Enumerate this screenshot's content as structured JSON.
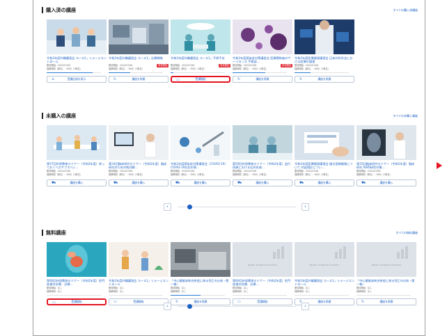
{
  "purchased": {
    "title": "購入済の講座",
    "link": "すべての購入済講座",
    "cards": [
      {
        "title": "令和2年度外職講習会 コース1」リメージコントロール",
        "tag": "",
        "meta1": "配信開始：2022/07/05",
        "meta2": "講師時間（単位）：60分（1単位）",
        "badge": "",
        "progress": 0.85,
        "button": "受講記録を表示",
        "icon": "user-icon",
        "scene": "team"
      },
      {
        "title": "令和2年度外職講習会 コース1」治療戦略",
        "tag": "",
        "meta1": "配信開始：2022/07/06",
        "meta2": "講師時間（単位）：60分（1単位）",
        "badge": "本日配信",
        "progress": 0.4,
        "button": "講座を再開",
        "icon": "refresh-icon",
        "scene": "lab"
      },
      {
        "title": "令和2年度外職講習会 コース1」手術手技",
        "tag": "",
        "meta1": "配信開始：2022/07/06",
        "meta2": "講師時間（単位）：60分（1単位）",
        "badge": "本日配信",
        "progress": 0.05,
        "button": "受講開始",
        "icon": "book-icon",
        "scene": "surgery"
      },
      {
        "title": "令和2年度感染症対策講習会 医療関係者のサーベランス 手術部…",
        "tag": "",
        "meta1": "配信開始：2022/07/06",
        "meta2": "講師時間（単位）：60分（1単位）",
        "badge": "本日配信",
        "progress": 0.6,
        "button": "講座を再開",
        "icon": "refresh-icon",
        "scene": "virus"
      },
      {
        "title": "令和2年度医療倫理講習会 日本外科学会における医療の倫理",
        "tag": "",
        "meta1": "配信開始：2022/07/06",
        "meta2": "講師時間（単位）：60分（1単位）",
        "badge": "",
        "progress": 0.3,
        "button": "講座を再開",
        "icon": "refresh-icon",
        "scene": "doctor"
      }
    ]
  },
  "unpurchased": {
    "title": "未購入の講座",
    "link": "すべての未購入講座",
    "cards": [
      {
        "title": "第57回外保教育セミナー（令和2年度）知っておくべきサブスペシ…",
        "tag": "",
        "meta1": "配信開始：2022/07/06",
        "meta2": "講師時間（単位）：60分（1単位）",
        "badge": "",
        "button": "講座を購入",
        "icon": "cart-icon",
        "scene": "meeting"
      },
      {
        "title": "第24回臨床研究セミナー（令和2年度）臨床研究のための統計解…",
        "tag": "",
        "meta1": "配信開始：2022/07/06",
        "meta2": "講師時間（単位）：60分（1単位）",
        "badge": "",
        "button": "講座を購入",
        "icon": "cart-icon",
        "scene": "office"
      },
      {
        "title": "令和2年度感染症対策講習会（COVID-19）COVID-19対応の現…",
        "tag": "",
        "meta1": "配信開始：2022/07/06",
        "meta2": "講師時間（単位）：60分（1単位）",
        "badge": "",
        "button": "講座を購入",
        "icon": "cart-icon",
        "scene": "vaccine"
      },
      {
        "title": "第59回外保教育セミナー（令和2年度）血行再建における石灰化病…",
        "tag": "",
        "meta1": "配信開始：2022/07/06",
        "meta2": "講師時間（単位）：60分（1単位）",
        "badge": "",
        "button": "講座を購入",
        "icon": "cart-icon",
        "scene": "surgery2"
      },
      {
        "title": "令和2年度医療倫理講習会 論文投稿倫理について 利益相反につい…",
        "tag": "",
        "meta1": "配信開始：2022/07/06",
        "meta2": "講師時間（単位）：60分（1単位）",
        "badge": "",
        "button": "講座を購入",
        "icon": "cart-icon",
        "scene": "hand"
      },
      {
        "title": "第25回臨床研究セミナー（令和2年度）臨床研究 RWD研究の最…",
        "tag": "",
        "meta1": "配信開始：2022/07/06",
        "meta2": "講師時間（単位）：60分（1単位）",
        "badge": "",
        "button": "講座を購入",
        "icon": "cart-icon",
        "scene": "xray"
      }
    ]
  },
  "free": {
    "title": "無料講座",
    "link": "すべての無料講座",
    "cards": [
      {
        "title": "第60回外保教育セミナー（令和2年度）肛門疾患の診療、治療…",
        "tag": "",
        "meta1": "配信開始：なし",
        "meta2": "講師時間：なし",
        "badge": "",
        "progress": 0.0,
        "button": "受講開始",
        "icon": "book-icon",
        "scene": "organs"
      },
      {
        "title": "令和2年度外職講習会 コース1」リメージコントロール",
        "tag": "",
        "meta1": "配信開始：なし",
        "meta2": "講師時間：なし",
        "badge": "",
        "progress": 0.0,
        "button": "受講開始",
        "icon": "book-icon",
        "scene": "people"
      },
      {
        "title": "「中心静脈穿刺合併症に係る死亡の分析 ─第一報─",
        "tag": "",
        "meta1": "配信開始：なし",
        "meta2": "講師時間：なし",
        "badge": "",
        "progress": 0.55,
        "button": "講座を再開",
        "icon": "refresh-icon",
        "scene": "ward"
      },
      {
        "title": "第60回外保教育セミナー（令和2年度）肛門疾患の診療、治療…",
        "tag": "",
        "meta1": "配信開始：なし",
        "meta2": "講師時間：なし",
        "badge": "",
        "progress": 0.0,
        "button": "受講開始",
        "icon": "book-icon",
        "scene": "placeholder"
      },
      {
        "title": "令和2年度外職講習会 コース1」リメージコントロール",
        "tag": "",
        "meta1": "配信開始：なし",
        "meta2": "講師時間：なし",
        "badge": "",
        "progress": 0.0,
        "button": "講座を再開",
        "icon": "refresh-icon",
        "scene": "placeholder"
      },
      {
        "title": "「中心静脈穿刺合併症に係る死亡の分析 ─第一報─",
        "tag": "",
        "meta1": "配信開始：なし",
        "meta2": "講師時間：なし",
        "badge": "",
        "progress": 0.0,
        "button": "講座を再開",
        "icon": "refresh-icon",
        "scene": "placeholder"
      }
    ]
  },
  "placeholder_text": "Japan Surgical Society",
  "pager": {
    "prev": "‹",
    "next": "›"
  },
  "colors": {
    "accent": "#1e63c4",
    "highlight": "#e3141f",
    "badge": "#e0323a"
  }
}
